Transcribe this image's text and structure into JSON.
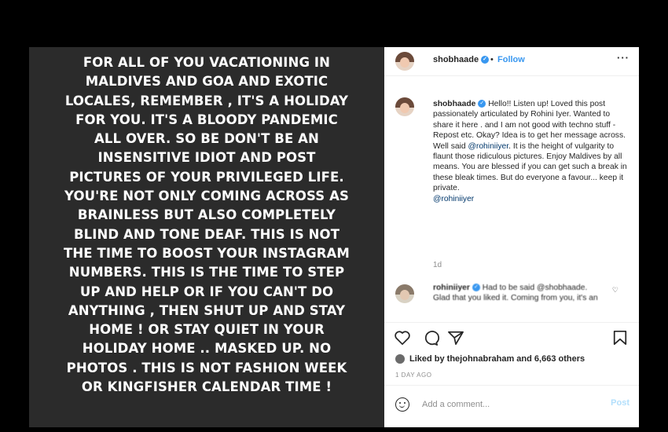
{
  "post_image": {
    "text": "FOR ALL OF YOU VACATIONING IN\nMALDIVES AND GOA AND EXOTIC\nLOCALES, REMEMBER , IT'S A HOLIDAY\nFOR  YOU. IT'S A BLOODY PANDEMIC\nALL OVER. SO BE DON'T BE AN\nINSENSITIVE  IDIOT AND POST\nPICTURES OF YOUR PRIVILEGED LIFE.\nYOU'RE NOT ONLY COMING ACROSS AS\nBRAINLESS  BUT ALSO COMPLETELY\nBLIND AND TONE DEAF. THIS IS NOT\nTHE TIME TO BOOST YOUR INSTAGRAM\nNUMBERS. THIS IS THE TIME TO STEP\nUP AND HELP OR IF YOU CAN'T DO\nANYTHING , THEN SHUT UP AND STAY\nHOME ! OR STAY QUIET IN YOUR\nHOLIDAY HOME .. MASKED UP. NO\nPHOTOS . THIS IS NOT FASHION WEEK\nOR KINGFISHER CALENDAR TIME !"
  },
  "header": {
    "username": "shobhaade",
    "separator": "•",
    "follow_label": "Follow",
    "more_icon": "more-options-icon"
  },
  "caption": {
    "username": "shobhaade",
    "text_before_mention": "Hello!! Listen up! Loved this post passionately articulated by Rohini Iyer. Wanted to share it here . and I am not good with techno stuff - Repost etc. Okay? Idea is to get her message across. Well said ",
    "mention": "@rohiniiyer",
    "text_after_mention": ". It is the height of vulgarity to flaunt those ridiculous pictures. Enjoy Maldives by all means. You are blessed if you can get such a break in these bleak times. But do everyone a favour... keep it private.",
    "tag": "@rohiniiyer",
    "time": "1d"
  },
  "comment": {
    "username": "rohiniiyer",
    "text": "Had to be said @shobhaade. Glad that you liked it. Coming from you, it's an"
  },
  "actions": {
    "icons": [
      "heart-icon",
      "comment-icon",
      "share-icon",
      "bookmark-icon"
    ]
  },
  "likes": {
    "text": "Liked by thejohnabraham and 6,663 others"
  },
  "date": "1 DAY AGO",
  "comment_box": {
    "placeholder": "Add a comment...",
    "post_label": "Post",
    "emoji_icon": "emoji-icon"
  },
  "colors": {
    "link_blue": "#3897f0",
    "post_background": "#2b2b2b",
    "post_button_disabled": "#b2dffc"
  }
}
